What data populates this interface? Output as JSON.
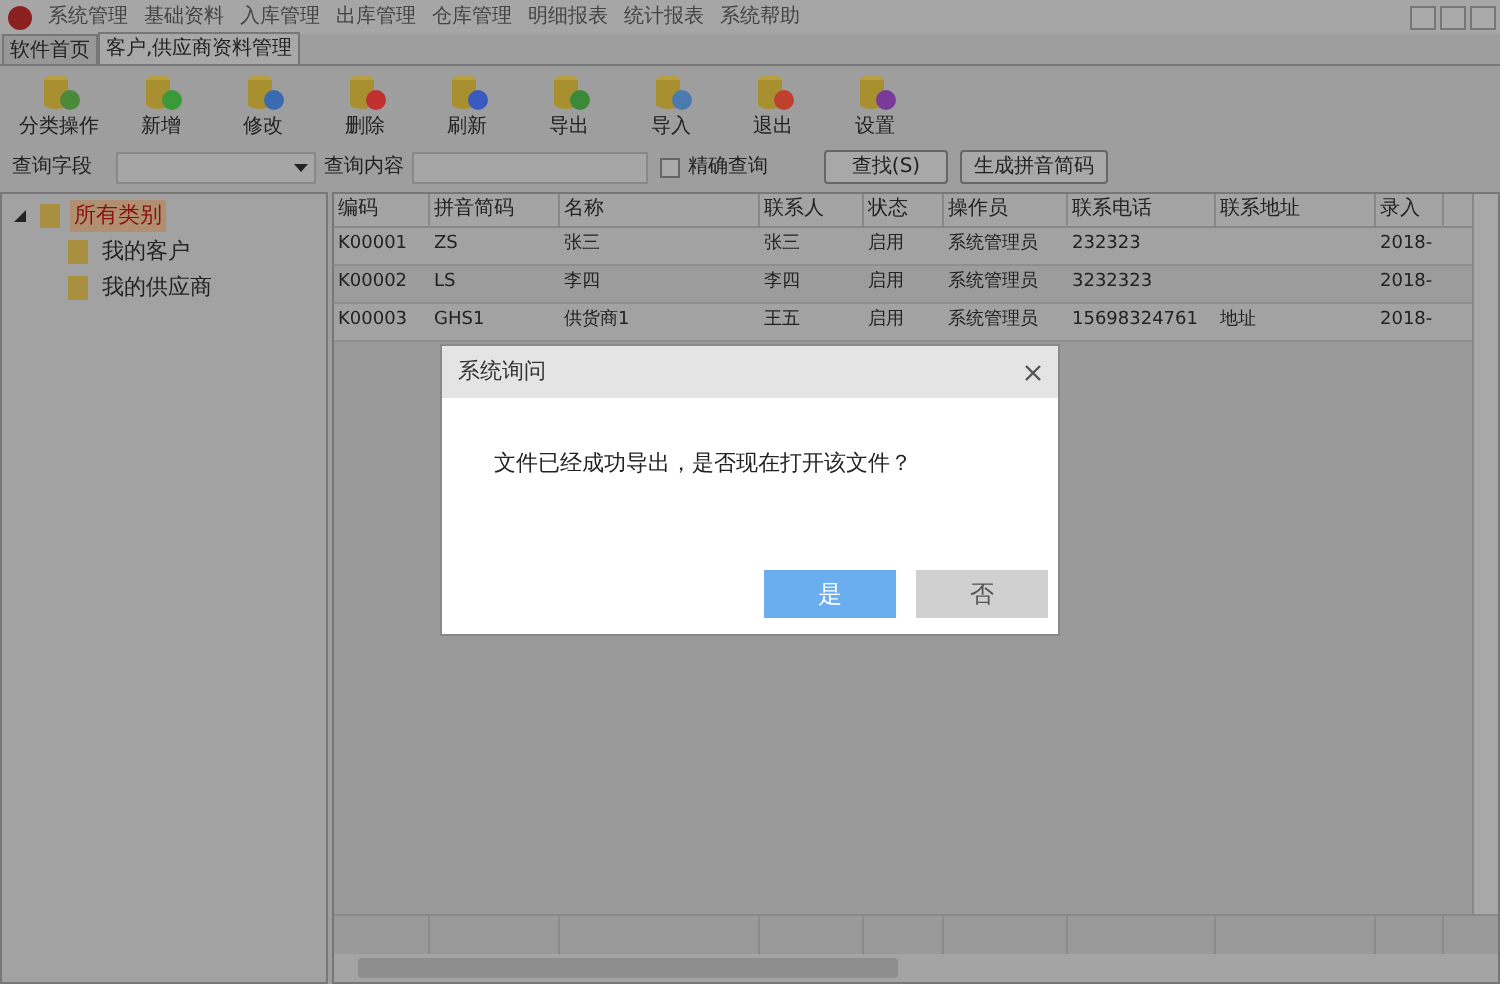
{
  "menu": [
    "系统管理",
    "基础资料",
    "入库管理",
    "出库管理",
    "仓库管理",
    "明细报表",
    "统计报表",
    "系统帮助"
  ],
  "tabs": [
    {
      "label": "软件首页",
      "selected": false
    },
    {
      "label": "客户,供应商资料管理",
      "selected": true
    }
  ],
  "toolbar": [
    "分类操作",
    "新增",
    "修改",
    "删除",
    "刷新",
    "导出",
    "导入",
    "退出",
    "设置"
  ],
  "search": {
    "field_label": "查询字段",
    "content_label": "查询内容",
    "exact": {
      "label": "精确查询",
      "checked": false
    },
    "buttons": [
      "查找(S)",
      "生成拼音简码"
    ]
  },
  "tree": [
    {
      "label": "所有类别",
      "selected": true,
      "expanded": true,
      "children": [
        {
          "label": "我的客户",
          "selected": false
        },
        {
          "label": "我的供应商",
          "selected": false
        }
      ]
    }
  ],
  "table": {
    "columns": [
      "编码",
      "拼音简码",
      "名称",
      "联系人",
      "状态",
      "操作员",
      "联系电话",
      "联系地址",
      "录入"
    ],
    "rows": [
      [
        "K00001",
        "ZS",
        "张三",
        "张三",
        "启用",
        "系统管理员",
        "232323",
        "",
        "2018-"
      ],
      [
        "K00002",
        "LS",
        "李四",
        "李四",
        "启用",
        "系统管理员",
        "3232323",
        "",
        "2018-"
      ],
      [
        "K00003",
        "GHS1",
        "供货商1",
        "王五",
        "启用",
        "系统管理员",
        "15698324761",
        "地址",
        "2018-"
      ]
    ]
  },
  "dialog": {
    "title": "系统询问",
    "message": "文件已经成功导出，是否现在打开该文件？",
    "buttons": [
      {
        "label": "是",
        "primary": true
      },
      {
        "label": "否",
        "primary": false
      }
    ]
  }
}
